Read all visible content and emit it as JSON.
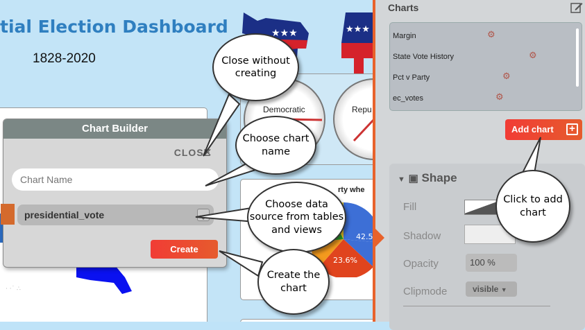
{
  "dashboard": {
    "title": "tial Election Dashboard",
    "years": "1828-2020",
    "gauge_left_label": "Democratic",
    "gauge_right_label": "Repu",
    "pie_title": "rty whe",
    "pie_labels": [
      "42.5",
      "23.6%",
      "%"
    ]
  },
  "chart_builder": {
    "title": "Chart Builder",
    "close_label": "CLOSE",
    "close_icon": "×",
    "name_placeholder": "Chart Name",
    "source_value": "presidential_vote",
    "create_label": "Create"
  },
  "right_panel": {
    "title": "Charts",
    "charts": [
      "Margin",
      "State Vote History",
      "Pct v Party",
      "ec_votes"
    ],
    "add_chart_label": "Add chart",
    "add_chart_icon": "+",
    "shape": {
      "header": "Shape",
      "fill_label": "Fill",
      "shadow_label": "Shadow",
      "opacity_label": "Opacity",
      "opacity_value": "100 %",
      "clipmode_label": "Clipmode",
      "clipmode_value": "visible"
    }
  },
  "callouts": {
    "close": "Close without creating",
    "name": "Choose chart name",
    "source": "Choose data source from tables and views",
    "create": "Create the chart",
    "add": "Click to add chart"
  },
  "colors": {
    "accent_red": "#f13c35",
    "accent_orange": "#e8622b",
    "title_blue": "#2f7fc0"
  }
}
